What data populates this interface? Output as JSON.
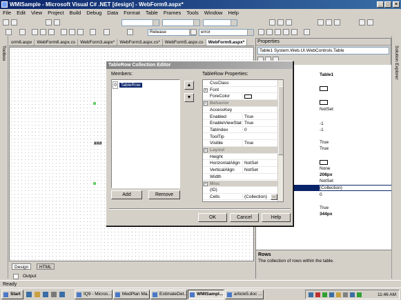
{
  "window": {
    "title": "WMISample - Microsoft Visual C# .NET [design] - WebForm9.aspx*"
  },
  "menu": [
    "File",
    "Edit",
    "View",
    "Project",
    "Build",
    "Debug",
    "Data",
    "Format",
    "Table",
    "Frames",
    "Tools",
    "Window",
    "Help"
  ],
  "toolbar": {
    "config_combo": "Release",
    "find_combo": "error"
  },
  "side": {
    "toolbox": "Toolbox",
    "solution_explorer": "Solution Explorer"
  },
  "doc_tabs": [
    "orm8.aspx",
    "WebForm8.aspx.cs",
    "WebForm3.aspx*",
    "WebForm3.aspx.cs*",
    "WebForm5.aspx.cs",
    "WebForm9.aspx*"
  ],
  "designer": {
    "placeholder": "###",
    "design_tab": "Design",
    "html_tab": "HTML",
    "output_tab": "Output"
  },
  "properties": {
    "title": "Properties",
    "object": "Table1  System.Web.UI.WebControls.Table",
    "values": [
      "Table1",
      "",
      "",
      "NotSet",
      "",
      "-1",
      "-1",
      "",
      "True",
      "True",
      "",
      "None",
      "208px",
      "NotSet",
      "(Collection)",
      "0",
      "",
      "True",
      "344px"
    ],
    "desc_title": "Rows",
    "desc_text": "The collection of rows within the table."
  },
  "dialog": {
    "title": "TableRow Collection Editor",
    "members_label": "Members:",
    "member_index": "0",
    "member_name": "TableRow",
    "props_label": "TableRow Properties:",
    "add": "Add",
    "remove": "Remove",
    "ok": "OK",
    "cancel": "Cancel",
    "help": "Help",
    "grid": [
      {
        "name": "CssClass",
        "value": "",
        "kind": "prop"
      },
      {
        "name": "Font",
        "value": "",
        "kind": "plus"
      },
      {
        "name": "ForeColor",
        "value": "",
        "kind": "color"
      },
      {
        "name": "Behavior",
        "value": "",
        "kind": "cat"
      },
      {
        "name": "AccessKey",
        "value": "",
        "kind": "prop"
      },
      {
        "name": "Enabled",
        "value": "True",
        "kind": "prop"
      },
      {
        "name": "EnableViewState",
        "value": "True",
        "kind": "prop"
      },
      {
        "name": "TabIndex",
        "value": "0",
        "kind": "prop"
      },
      {
        "name": "ToolTip",
        "value": "",
        "kind": "prop"
      },
      {
        "name": "Visible",
        "value": "True",
        "kind": "prop"
      },
      {
        "name": "Layout",
        "value": "",
        "kind": "cat"
      },
      {
        "name": "Height",
        "value": "",
        "kind": "prop"
      },
      {
        "name": "HorizontalAlign",
        "value": "NotSet",
        "kind": "prop"
      },
      {
        "name": "VerticalAlign",
        "value": "NotSet",
        "kind": "prop"
      },
      {
        "name": "Width",
        "value": "",
        "kind": "prop"
      },
      {
        "name": "Misc",
        "value": "",
        "kind": "cat"
      },
      {
        "name": "(ID)",
        "value": "",
        "kind": "prop"
      },
      {
        "name": "Cells",
        "value": "(Collection)",
        "kind": "prop"
      }
    ]
  },
  "statusbar": {
    "text": "Ready"
  },
  "taskbar": {
    "start": "Start",
    "tasks": [
      "IQ9 - Micros...",
      "MedPlan Ma...",
      "EstimateDet...",
      "WMISampl...",
      "article5.doc ..."
    ],
    "clock": "11:46 AM"
  },
  "colors": {
    "titlebar": "#0a246a",
    "selection": "#0a246a",
    "face": "#d4d0c8"
  }
}
